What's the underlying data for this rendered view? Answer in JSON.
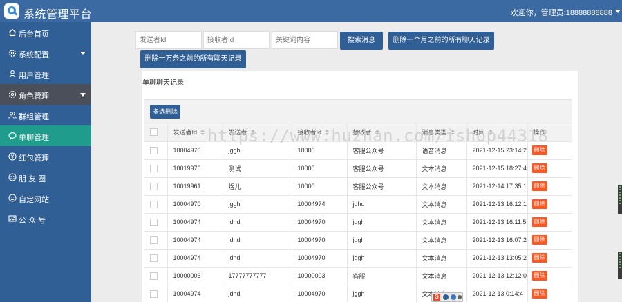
{
  "header": {
    "app_title": "系统管理平台",
    "user_info": "欢迎你，管理员:18888888888"
  },
  "sidebar": {
    "items": [
      {
        "label": "后台首页",
        "icon": "home-icon"
      },
      {
        "label": "系统配置",
        "icon": "settings-gear-icon"
      },
      {
        "label": "用户管理",
        "icon": "user-icon"
      },
      {
        "label": "角色管理",
        "icon": "settings-gear-icon"
      },
      {
        "label": "群组管理",
        "icon": "group-users-icon"
      },
      {
        "label": "单聊管理",
        "icon": "chat-bubble-icon"
      },
      {
        "label": "红包管理",
        "icon": "red-envelope-icon"
      },
      {
        "label": "朋 友 圈",
        "icon": "smile-face-icon"
      },
      {
        "label": "自定网站",
        "icon": "smile-face-icon"
      },
      {
        "label": "公 众 号",
        "icon": "image-icon"
      }
    ]
  },
  "filters": {
    "sender_placeholder": "发送者Id",
    "receiver_placeholder": "接收者Id",
    "keyword_placeholder": "关键词内容",
    "search_label": "搜索消息",
    "delete_month_label": "删除一个月之前的所有聊天记录",
    "delete_100k_label": "删除十万条之前的所有聊天记录"
  },
  "panel": {
    "title": "单聊聊天记录",
    "watermark": "https://www.huzhan.com/ishop44318",
    "bulk_delete_label": "多选删除"
  },
  "table": {
    "headers": {
      "sender_id": "发送者Id",
      "sender": "发送者",
      "receiver_id": "接收者Id",
      "receiver": "接收者",
      "msg_type": "消息类型",
      "time": "时间",
      "actions": "操作"
    },
    "delete_label": "删除",
    "rows": [
      {
        "sender_id": "10004970",
        "sender": "jggh",
        "receiver_id": "10000",
        "receiver": "客服公众号",
        "msg_type": "语音消息",
        "time": "2021-12-15 23:14:2"
      },
      {
        "sender_id": "10019976",
        "sender": "测试",
        "receiver_id": "10000",
        "receiver": "客服公众号",
        "msg_type": "文本消息",
        "time": "2021-12-15 18:27:4"
      },
      {
        "sender_id": "10019961",
        "sender": "煜儿",
        "receiver_id": "10000",
        "receiver": "客服公众号",
        "msg_type": "文本消息",
        "time": "2021-12-14 17:35:1"
      },
      {
        "sender_id": "10004970",
        "sender": "jggh",
        "receiver_id": "10004974",
        "receiver": "jdhd",
        "msg_type": "文本消息",
        "time": "2021-12-13 16:12:1"
      },
      {
        "sender_id": "10004974",
        "sender": "jdhd",
        "receiver_id": "10004970",
        "receiver": "jggh",
        "msg_type": "文本消息",
        "time": "2021-12-13 16:11:5"
      },
      {
        "sender_id": "10004974",
        "sender": "jdhd",
        "receiver_id": "10004970",
        "receiver": "jggh",
        "msg_type": "文本消息",
        "time": "2021-12-13 16:07:2"
      },
      {
        "sender_id": "10004974",
        "sender": "jdhd",
        "receiver_id": "10004970",
        "receiver": "jggh",
        "msg_type": "文本消息",
        "time": "2021-12-13 13:05:2"
      },
      {
        "sender_id": "10000006",
        "sender": "17777777777",
        "receiver_id": "10000003",
        "receiver": "客服",
        "msg_type": "文本消息",
        "time": "2021-12-13 12:12:0"
      },
      {
        "sender_id": "10004974",
        "sender": "jdhd",
        "receiver_id": "10004970",
        "receiver": "jggh",
        "msg_type": "文本消息",
        "time": "2021-12-13 0:14:4"
      }
    ]
  },
  "ime": {
    "logo": "S"
  },
  "colors": {
    "header_bg": "#3a6aa1",
    "sidebar_bg": "#2f5f95",
    "active_item": "#1f9c8b",
    "group_item": "#4a4f5a",
    "button_primary": "#2f5f95",
    "delete_button": "#ff5722"
  }
}
